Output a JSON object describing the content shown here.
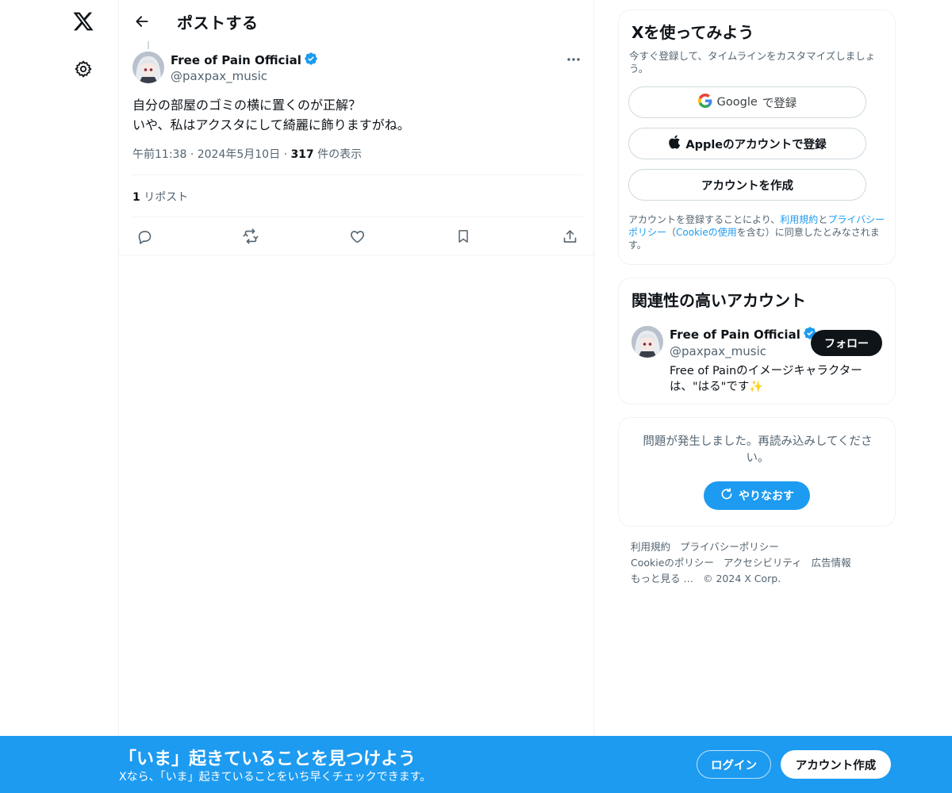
{
  "nav": {
    "logo_icon": "x-logo-icon",
    "settings_icon": "gear-icon"
  },
  "header": {
    "title": "ポストする"
  },
  "post": {
    "author_name": "Free of Pain Official",
    "author_handle": "@paxpax_music",
    "text_line1": "自分の部屋のゴミの横に置くのが正解？",
    "text_line2": "いや、私はアクスタにして綺麗に飾りますがね。",
    "time": "午前11:38",
    "date": "2024年5月10日",
    "views_count": "317",
    "views_label": "件の表示",
    "repost_count": "1",
    "repost_label": "リポスト"
  },
  "signup": {
    "title": "Xを使ってみよう",
    "subtitle": "今すぐ登録して、タイムラインをカスタマイズしましょう。",
    "google_brand": "Google",
    "google_suffix": "で登録",
    "apple_label": "Appleのアカウントで登録",
    "create_label": "アカウントを作成",
    "terms_1": "アカウントを登録することにより、",
    "terms_link1": "利用規約",
    "terms_2": "と",
    "terms_link2": "プライバシーポリシー",
    "terms_3": "（",
    "terms_link3": "Cookieの使用",
    "terms_4": "を含む）に同意したとみなされます。"
  },
  "related": {
    "title": "関連性の高いアカウント",
    "name": "Free of Pain Official",
    "handle": "@paxpax_music",
    "bio": "Free of Painのイメージキャラクターは、\"はる\"です✨",
    "follow_label": "フォロー"
  },
  "error": {
    "message": "問題が発生しました。再読み込みしてください。",
    "retry_label": "やりなおす"
  },
  "footer": {
    "links": [
      "利用規約",
      "プライバシーポリシー",
      "Cookieのポリシー",
      "アクセシビリティ",
      "広告情報",
      "もっと見る …"
    ],
    "copyright": "© 2024 X Corp."
  },
  "bottombar": {
    "title": "「いま」起きていることを見つけよう",
    "subtitle": "Xなら、「いま」起きていることをいち早くチェックできます。",
    "login_label": "ログイン",
    "signup_label": "アカウント作成"
  },
  "colors": {
    "accent": "#1d9bf0",
    "text": "#0f1419",
    "muted": "#536471",
    "border": "#eff3f4"
  }
}
